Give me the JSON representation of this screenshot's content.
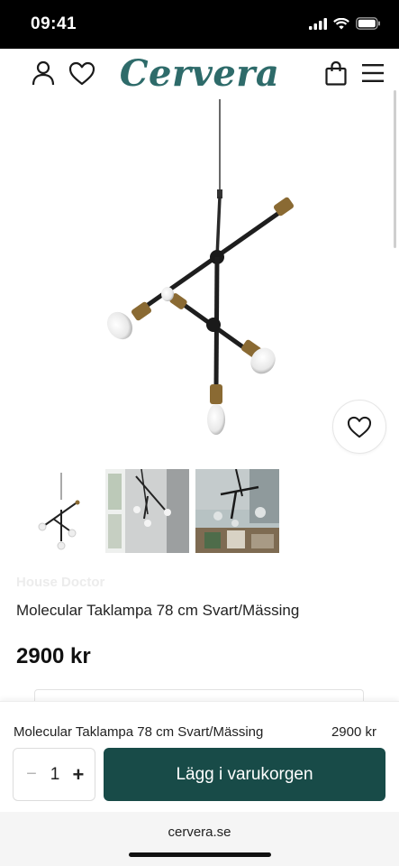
{
  "status": {
    "time": "09:41"
  },
  "header": {
    "logo": "Cervera"
  },
  "product": {
    "brand": "House Doctor",
    "title": "Molecular Taklampa 78 cm Svart/Mässing",
    "price": "2900 kr"
  },
  "sticky": {
    "title": "Molecular Taklampa 78 cm Svart/Mässing",
    "price": "2900 kr",
    "qty_minus": "−",
    "quantity": "1",
    "qty_plus": "+",
    "add_label": "Lägg i varukorgen"
  },
  "browser": {
    "url": "cervera.se"
  },
  "colors": {
    "brand_teal": "#2e6b6a",
    "button_green": "#184b48"
  },
  "icons": [
    "user-icon",
    "heart-icon",
    "bag-icon",
    "menu-icon",
    "signal-icon",
    "wifi-icon",
    "battery-icon"
  ]
}
